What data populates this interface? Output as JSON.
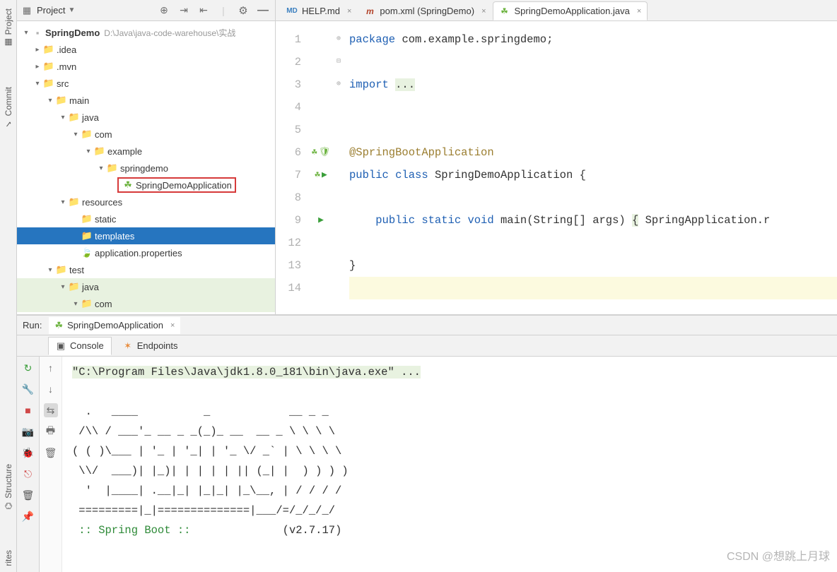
{
  "leftStrip": {
    "project": "Project",
    "commit": "Commit",
    "structure": "Structure",
    "favs": "rites"
  },
  "projPanel": {
    "title": "Project"
  },
  "tree": {
    "root": {
      "name": "SpringDemo",
      "path": "D:\\Java\\java-code-warehouse\\实战"
    },
    "idea": ".idea",
    "mvn": ".mvn",
    "src": "src",
    "main": "main",
    "java": "java",
    "com": "com",
    "example": "example",
    "springdemo": "springdemo",
    "appClass": "SpringDemoApplication",
    "resources": "resources",
    "static": "static",
    "templates": "templates",
    "appProps": "application.properties",
    "test": "test",
    "tjava": "java",
    "tcom": "com"
  },
  "tabs": {
    "help": "HELP.md",
    "pom": "pom.xml (SpringDemo)",
    "app": "SpringDemoApplication.java"
  },
  "code": {
    "l1": "package com.example.springdemo;",
    "l4a": "import ",
    "l4b": "...",
    "l6": "@SpringBootApplication",
    "l7a": "public class ",
    "l7b": "SpringDemoApplication {",
    "l9a": "    public static void ",
    "l9b": "main",
    "l9c": "(String[] args) ",
    "l9d": "{",
    "l9e": " SpringApplication.r",
    "l13": "}",
    "nums": [
      "1",
      "2",
      "3",
      "4",
      "5",
      "6",
      "7",
      "8",
      "9",
      "12",
      "13",
      "14"
    ]
  },
  "run": {
    "label": "Run:",
    "app": "SpringDemoApplication",
    "console": "Console",
    "endpoints": "Endpoints",
    "cmd": "\"C:\\Program Files\\Java\\jdk1.8.0_181\\bin\\java.exe\" ...",
    "ascii": "  .   ____          _            __ _ _\n /\\\\ / ___'_ __ _ _(_)_ __  __ _ \\ \\ \\ \\\n( ( )\\___ | '_ | '_| | '_ \\/ _` | \\ \\ \\ \\\n \\\\/  ___)| |_)| | | | | || (_| |  ) ) ) )\n  '  |____| .__|_| |_|_| |_\\__, | / / / /\n =========|_|==============|___/=/_/_/_/",
    "boot": " :: Spring Boot :: ",
    "ver": "             (v2.7.17)"
  },
  "watermark": "CSDN @想跳上月球"
}
